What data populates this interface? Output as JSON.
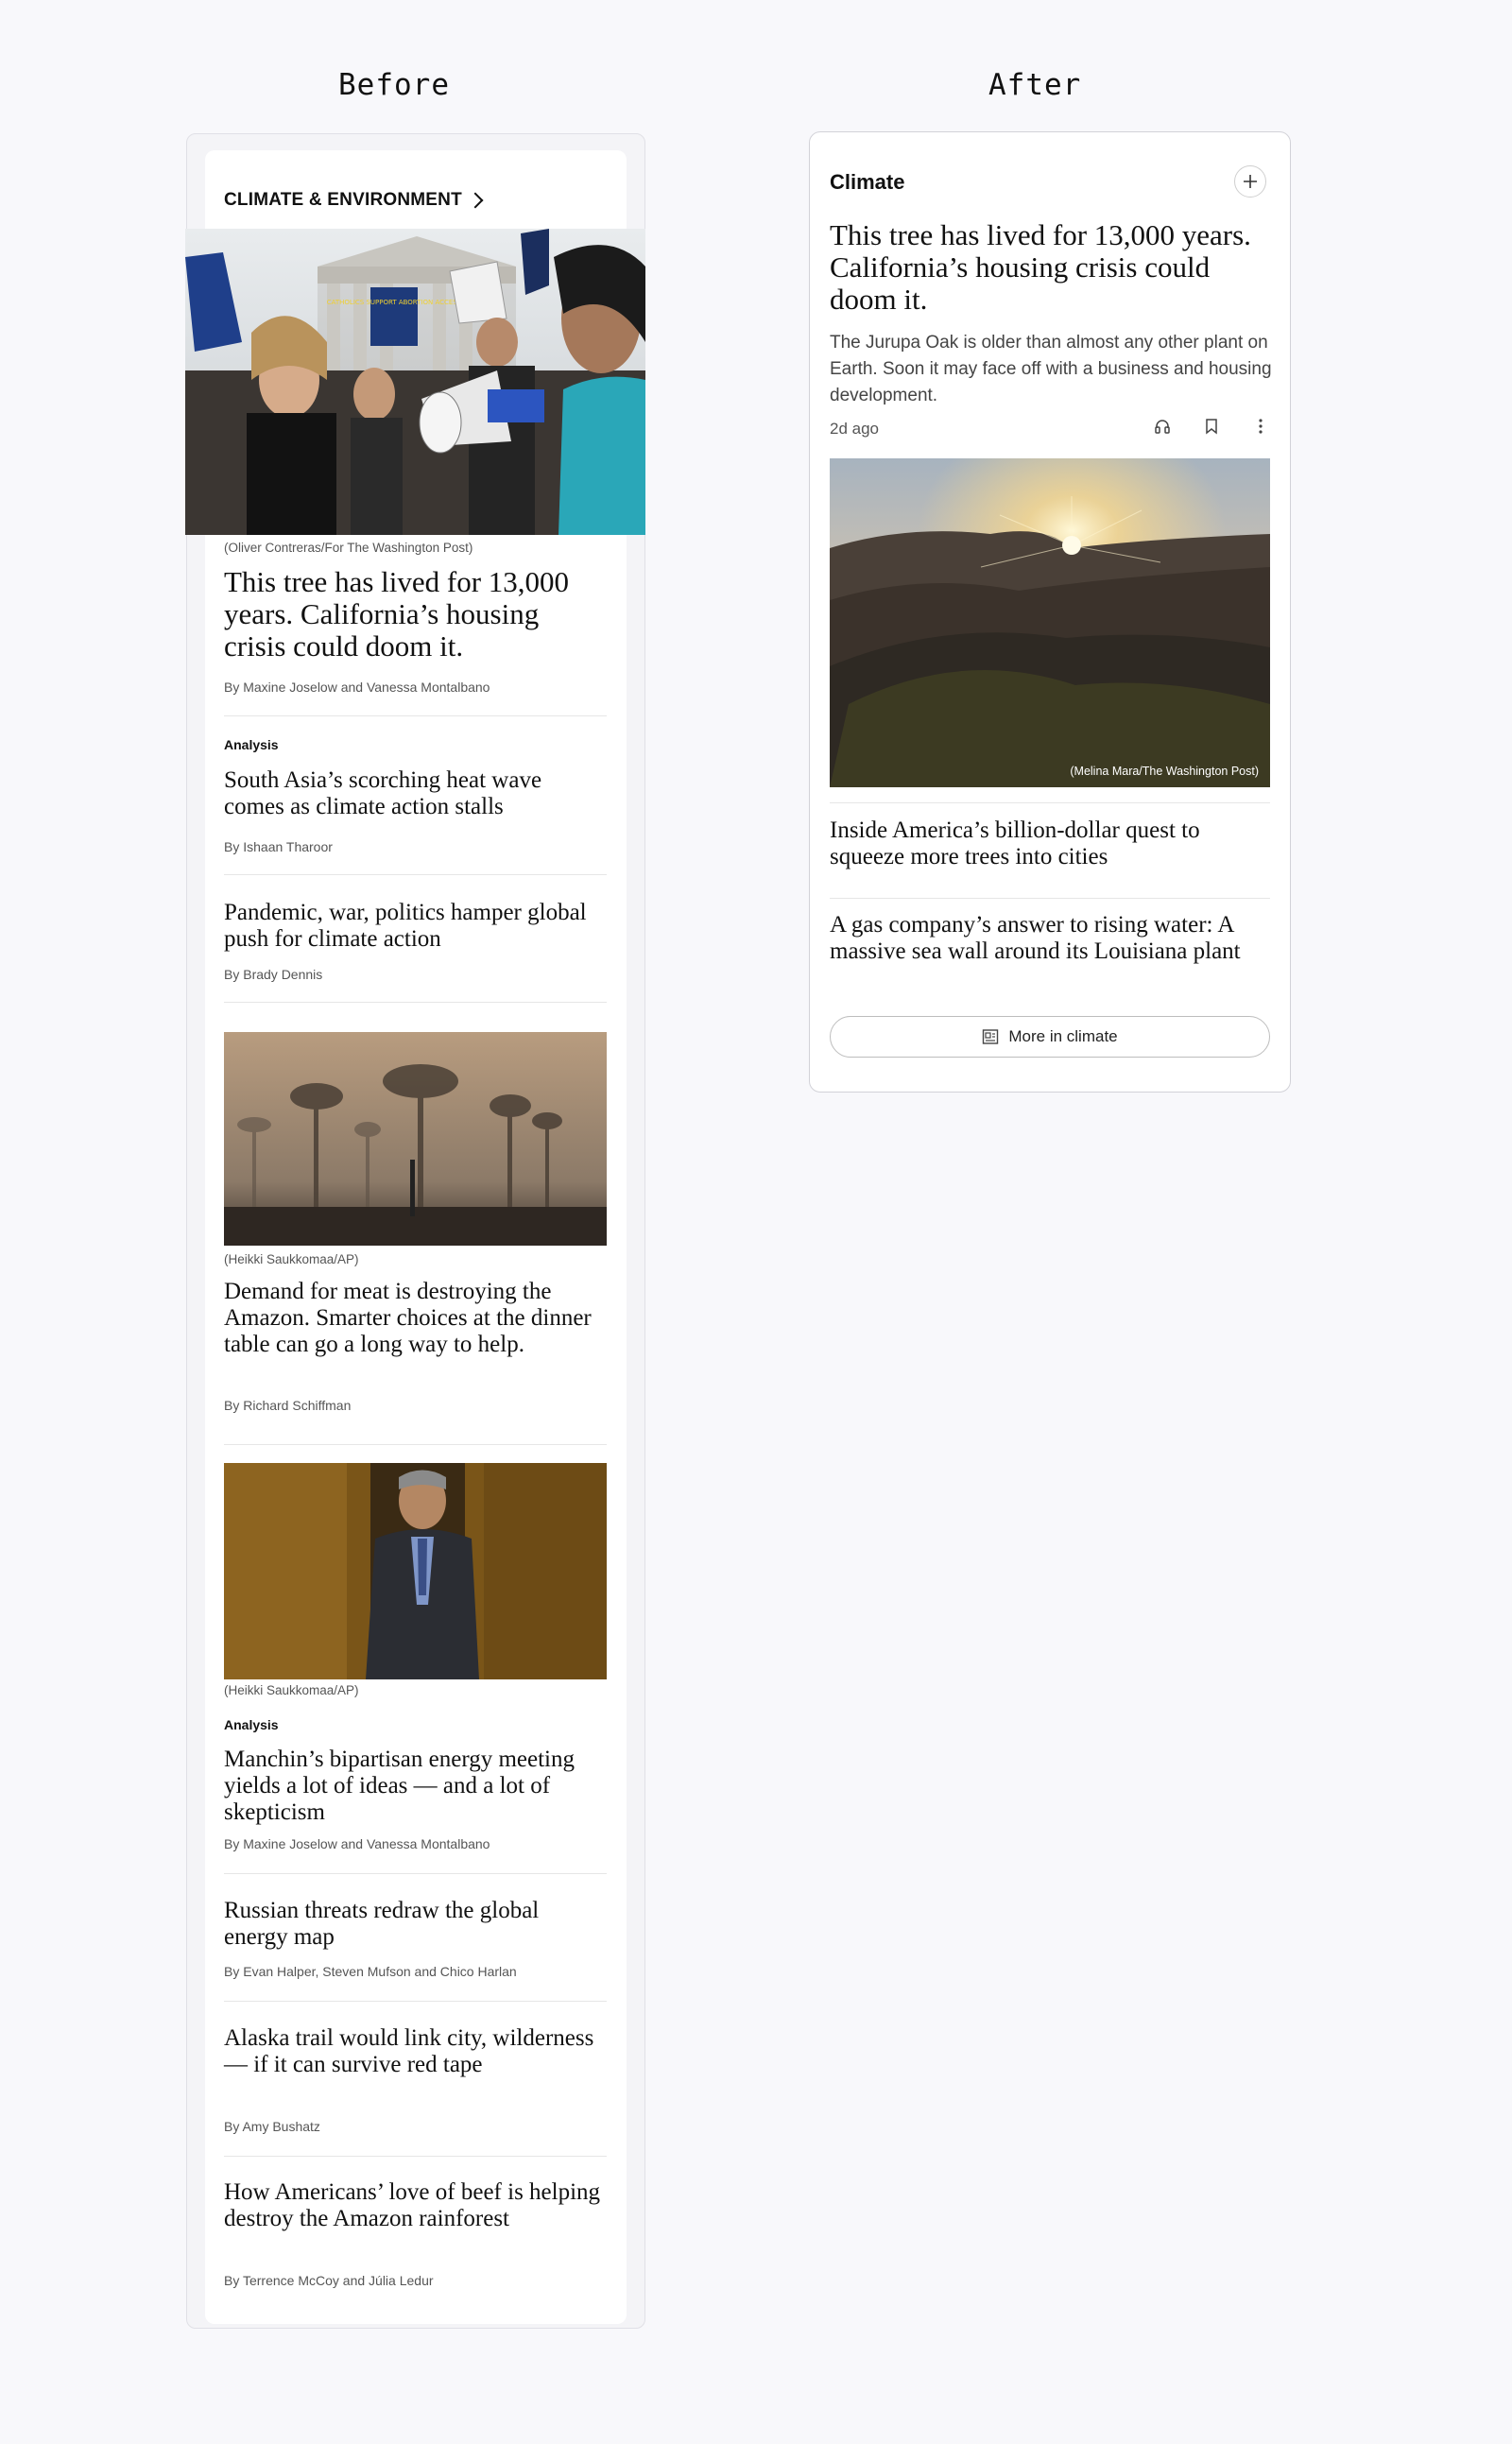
{
  "labels": {
    "before": "Before",
    "after": "After"
  },
  "before": {
    "section_link": "CLIMATE & ENVIRONMENT",
    "hero": {
      "credit": "(Oliver Contreras/For The Washington Post)",
      "headline": "This tree has lived for 13,000 years. California’s housing crisis could doom it.",
      "byline": "By Maxine Joselow and Vanessa Montalbano",
      "sign_text": "CATHOLICS SUPPORT ABORTION ACCESS"
    },
    "stories": [
      {
        "kicker": "Analysis",
        "headline": "South Asia’s scorching heat wave comes as climate action stalls",
        "byline": "By Ishaan Tharoor"
      },
      {
        "headline": "Pandemic, war, politics hamper global push for climate action",
        "byline": "By Brady Dennis"
      },
      {
        "credit": "(Heikki Saukkomaa/AP)",
        "headline": "Demand for meat is destroying the Amazon. Smarter choices at the dinner table can go a long way to help.",
        "byline": "By Richard Schiffman"
      },
      {
        "credit": "(Heikki Saukkomaa/AP)",
        "kicker": "Analysis",
        "headline": "Manchin’s bipartisan energy meeting yields a lot of ideas — and a lot of skepticism",
        "byline": "By Maxine Joselow and Vanessa Montalbano"
      },
      {
        "headline": "Russian threats redraw the global energy map",
        "byline": "By Evan Halper, Steven Mufson and Chico Harlan"
      },
      {
        "headline": "Alaska trail would link city, wilderness — if it can survive red tape",
        "byline": "By Amy Bushatz"
      },
      {
        "headline": "How Americans’ love of beef is helping destroy the Amazon rainforest",
        "byline": "By Terrence McCoy and Júlia Ledur"
      }
    ]
  },
  "after": {
    "title": "Climate",
    "headline": "This tree has lived for 13,000 years. California’s housing crisis could doom it.",
    "dek": "The Jurupa Oak is older than almost any other plant on Earth. Soon it may face off with a business and housing development.",
    "time_ago": "2d ago",
    "image_credit": "(Melina Mara/The Washington Post)",
    "stories": [
      {
        "headline": "Inside America’s billion-dollar quest to squeeze more trees into cities"
      },
      {
        "headline": "A gas company’s answer to rising water: A massive sea wall around its Louisiana plant"
      }
    ],
    "more_button": "More in climate",
    "icons": [
      "plus-icon",
      "headphones-icon",
      "bookmark-icon",
      "more-vertical-icon",
      "newspaper-icon"
    ]
  }
}
